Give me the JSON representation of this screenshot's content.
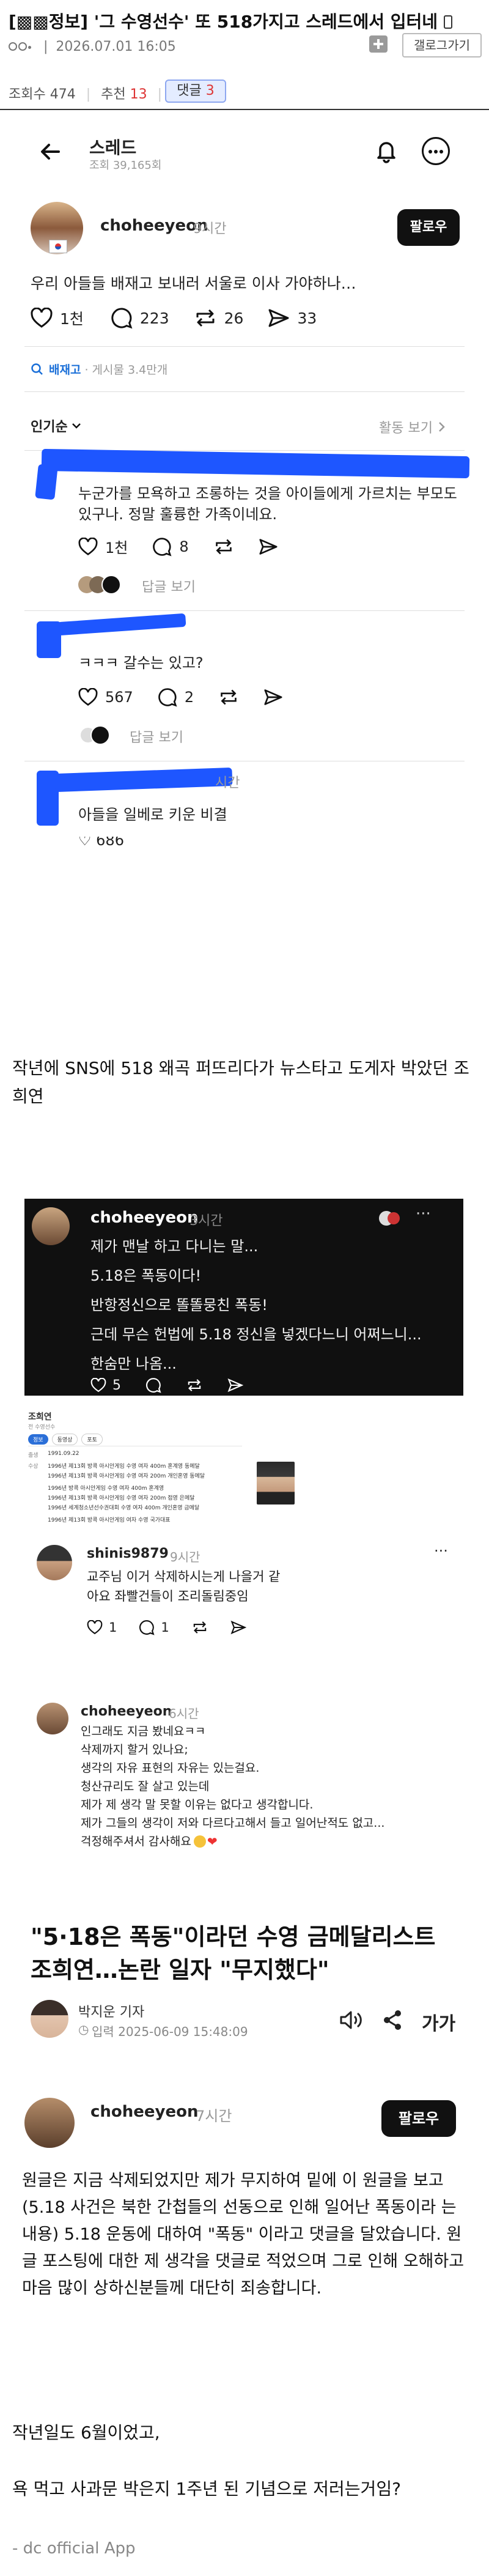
{
  "post": {
    "category": "[▩▩정보]",
    "title": "'그 수영선수' 또 518가지고 스레드에서 입터네",
    "date": "2026.07.01 16:05",
    "gallery_btn": "갤로그가기",
    "views_label": "조회수",
    "views": "474",
    "recommend_label": "추천",
    "recommend": "13",
    "comments_label": "댓글",
    "comments": "3"
  },
  "shot1": {
    "header_title": "스레드",
    "header_sub": "조회 39,165회",
    "author": "choheeyeon",
    "time": "9시간",
    "follow": "팔로우",
    "text": "우리 아들들 배재고 보내러 서울로 이사 가야하나…",
    "likes": "1천",
    "comments": "223",
    "reposts": "26",
    "shares": "33",
    "tag": "배재고",
    "tag_meta": "· 게시물 3.4만개",
    "sort": "인기순",
    "activity": "활동 보기",
    "reply1_text": "누군가를 모욕하고 조롱하는 것을 아이들에게 가르치는 부모도 있구나. 정말 훌륭한 가족이네요.",
    "reply1_likes": "1천",
    "reply1_comments": "8",
    "reply1_more": "답글 보기",
    "reply2_text": "ㅋㅋㅋ 갈수는 있고?",
    "reply2_likes": "567",
    "reply2_comments": "2",
    "reply2_more": "답글 보기",
    "reply3_time": "시간",
    "reply3_text": "아들을 일베로 키운 비결",
    "reply3_likes": "686"
  },
  "body1": "작년에 SNS에 518 왜곡 퍼뜨리다가 뉴스타고 도게자 박았던 조희연",
  "shot2": {
    "author": "choheeyeon",
    "time": "3시간",
    "lines": [
      "제가 맨날 하고 다니는 말...",
      "5.18은 폭동이다!",
      "반항정신으로 똘똘뭉친 폭동!",
      "근데 무슨 헌법에 5.18 정신을 넣겠다느니 어쩌느니...",
      "한숨만 나옴..."
    ],
    "likes": "5"
  },
  "profile_card": {
    "name": "조희연",
    "sub": "전 수영선수",
    "tabs": [
      "정보",
      "동영상",
      "포토"
    ],
    "dob_label": "출생",
    "dob": "1991.09.22",
    "career_label": "수상",
    "career": [
      "1996년 제13회 방콕 아시안게임 수영 여자 400m 혼계영 동메달",
      "1996년 제13회 방콕 아시안게임 수영 여자 200m 개인혼영 동메달",
      "1996년 방콕 아시안게임 수영 여자 400m 혼계영",
      "1996년 제13회 방콕 아시안게임 수영 여자 200m 접영 은메달",
      "1996년 세계청소년선수권대회 수영 여자 400m 개인혼영 금메달",
      "1996년 제13회 방콕 아시안게임 여자 수영 국가대표"
    ]
  },
  "shot3": {
    "author": "shinis9879",
    "time": "9시간",
    "text": "교주님 이거 삭제하시는게 나을거 같아요 좌빨건들이 조리돌림중임",
    "likes": "1",
    "comments": "1"
  },
  "shot4": {
    "author": "choheeyeon",
    "time": "6시간",
    "lines": [
      "인그래도 지금 봤네요ㅋㅋ",
      "삭제까지 할거 있나요;",
      "생각의 자유 표현의 자유는 있는걸요.",
      "청산규리도 잘 살고 있는데",
      "제가 제 생각 말 못할 이유는 없다고 생각합니다.",
      "제가 그들의 생각이 저와 다르다고해서 들고 일어난적도 없고...",
      "걱정해주셔서 감사해요"
    ]
  },
  "article": {
    "headline": "\"5·18은 폭동\"이라던 수영 금메달리스트 조희연…논란 일자 \"무지했다\"",
    "reporter": "박지운 기자",
    "date": "입력 2025-06-09 15:48:09",
    "font_btn": "가가"
  },
  "shot5": {
    "author": "choheeyeon",
    "time": "7시간",
    "follow": "팔로우",
    "text": "원글은 지금 삭제되었지만 제가 무지하여 밑에 이 원글을 보고 (5.18 사건은 북한 간첩들의 선동으로 인해 일어난 폭동이라 는 내용) 5.18 운동에 대하여 \"폭동\" 이라고 댓글을 달았습니다. 원글 포스팅에 대한 제 생각을 댓글로 적었으며 그로 인해 오해하고 마음 많이 상하신분들께 대단히 죄송합니다."
  },
  "body2": "작년일도 6월이었고,",
  "body3": "욕 먹고 사과문 박은지 1주년 된 기념으로 저러는거임?",
  "footer": "- dc official App"
}
